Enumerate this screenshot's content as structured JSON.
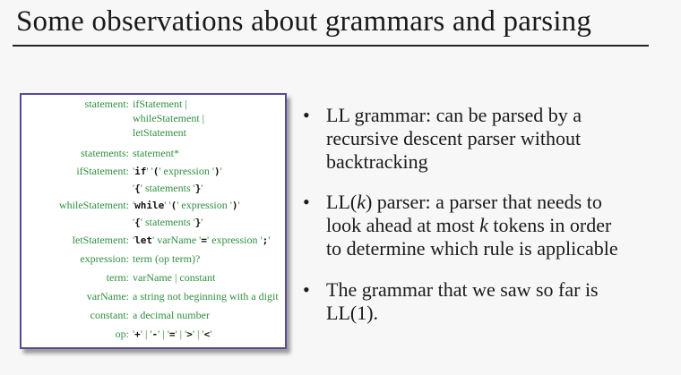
{
  "slide": {
    "title": "Some observations about grammars and parsing"
  },
  "grammar": {
    "rules": [
      {
        "name": "statement:",
        "lines": [
          "ifStatement |",
          "whileStatement |",
          "letStatement"
        ]
      },
      {
        "name": "statements:",
        "lines": [
          "statement*"
        ]
      },
      {
        "name": "ifStatement:",
        "parts_1": [
          "'",
          "if",
          "' '",
          "(",
          "' expression '",
          ")",
          "'"
        ],
        "parts_2": [
          "'",
          "{",
          "' statements '",
          "}",
          "'"
        ]
      },
      {
        "name": "whileStatement:",
        "parts_1": [
          "'",
          "while",
          "' '",
          "(",
          "' expression '",
          ")",
          "'"
        ],
        "parts_2": [
          "'",
          "{",
          "' statements '",
          "}",
          "'"
        ]
      },
      {
        "name": "letStatement:",
        "parts_1": [
          "'",
          "let",
          "' varName '",
          "=",
          "' expression '",
          ";",
          "'"
        ]
      },
      {
        "name": "expression:",
        "lines": [
          "term (op term)?"
        ]
      },
      {
        "name": "term:",
        "lines": [
          "varName | constant"
        ]
      },
      {
        "name": "varName:",
        "lines": [
          "a string not beginning with a digit"
        ]
      },
      {
        "name": "constant:",
        "lines": [
          "a decimal number"
        ]
      },
      {
        "name": "op:",
        "parts_1": [
          "'",
          "+",
          "' | '",
          "-",
          "' | '",
          "=",
          "' | '",
          ">",
          "' | '",
          "<",
          "'"
        ]
      }
    ]
  },
  "bullets": [
    {
      "symbol": "•",
      "lines": [
        "LL grammar:  can be parsed by a",
        "recursive descent parser without",
        "backtracking"
      ]
    },
    {
      "symbol": "•",
      "prefix": "LL(",
      "k": "k",
      "suffix": ") parser: a parser that needs to",
      "lines": [
        "look ahead at most ",
        " tokens in order",
        "to determine which rule is applicable"
      ]
    },
    {
      "symbol": "•",
      "lines": [
        "The grammar that we saw so far is",
        "LL(1)."
      ]
    }
  ]
}
